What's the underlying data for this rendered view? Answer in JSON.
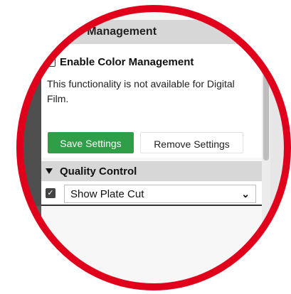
{
  "section": {
    "title": "Color Management"
  },
  "color_management": {
    "enable_label": "Enable Color Management",
    "enabled": false,
    "info": "This functionality is not available for Digital Film."
  },
  "buttons": {
    "save_label": "Save Settings",
    "remove_label": "Remove Settings"
  },
  "quality_control": {
    "header": "Quality Control",
    "selected_option": "Show Plate Cut",
    "checked": true
  },
  "colors": {
    "accent_green": "#2f9e48",
    "annotation_red": "#e0001b",
    "header_gray": "#d7d7d7"
  }
}
